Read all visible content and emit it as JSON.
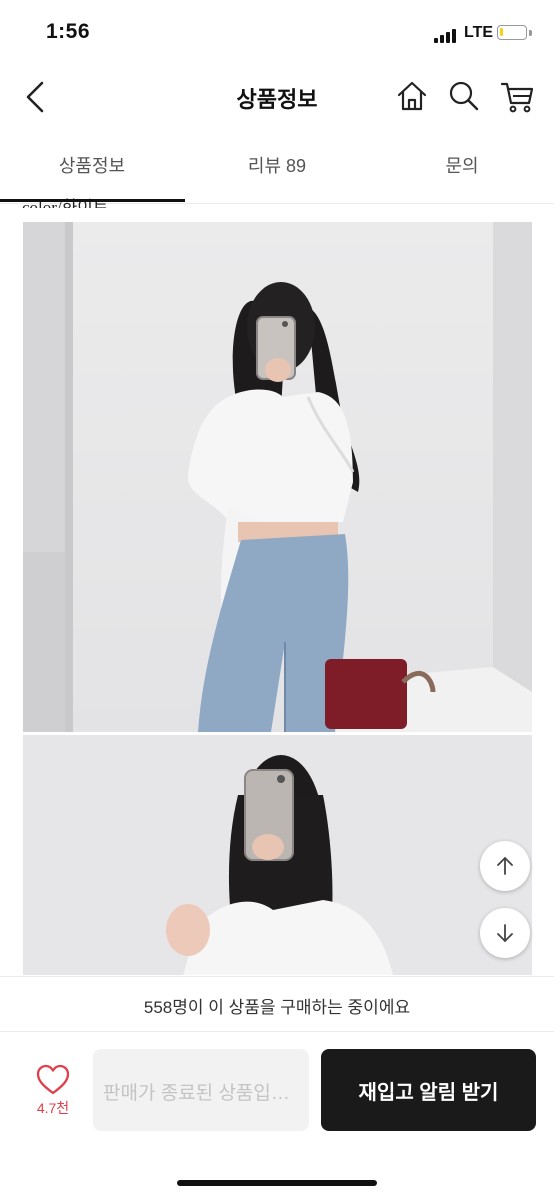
{
  "status_bar": {
    "time": "1:56",
    "network": "LTE",
    "battery_level": 0.15,
    "battery_color": "#f2d21a"
  },
  "header": {
    "title": "상품정보",
    "back_icon": "chevron-left-icon",
    "actions": [
      {
        "icon": "home-icon"
      },
      {
        "icon": "search-icon"
      },
      {
        "icon": "cart-icon"
      }
    ]
  },
  "tabs": [
    {
      "label": "상품정보",
      "active": true
    },
    {
      "label": "리뷰 89",
      "active": false
    },
    {
      "label": "문의",
      "active": false
    }
  ],
  "content": {
    "color_caption": "color/화이트",
    "images": [
      {
        "name": "product-photo-full-body"
      },
      {
        "name": "product-photo-closeup"
      }
    ]
  },
  "scroll_buttons": {
    "up_icon": "arrow-up-icon",
    "down_icon": "arrow-down-icon"
  },
  "notice": {
    "text": "558명이 이 상품을 구매하는 중이에요"
  },
  "bottom_bar": {
    "like_icon": "heart-icon",
    "like_count": "4.7천",
    "accent_color": "#e0404b",
    "ended_label": "판매가 종료된 상품입니다",
    "restock_label": "재입고 알림 받기"
  }
}
